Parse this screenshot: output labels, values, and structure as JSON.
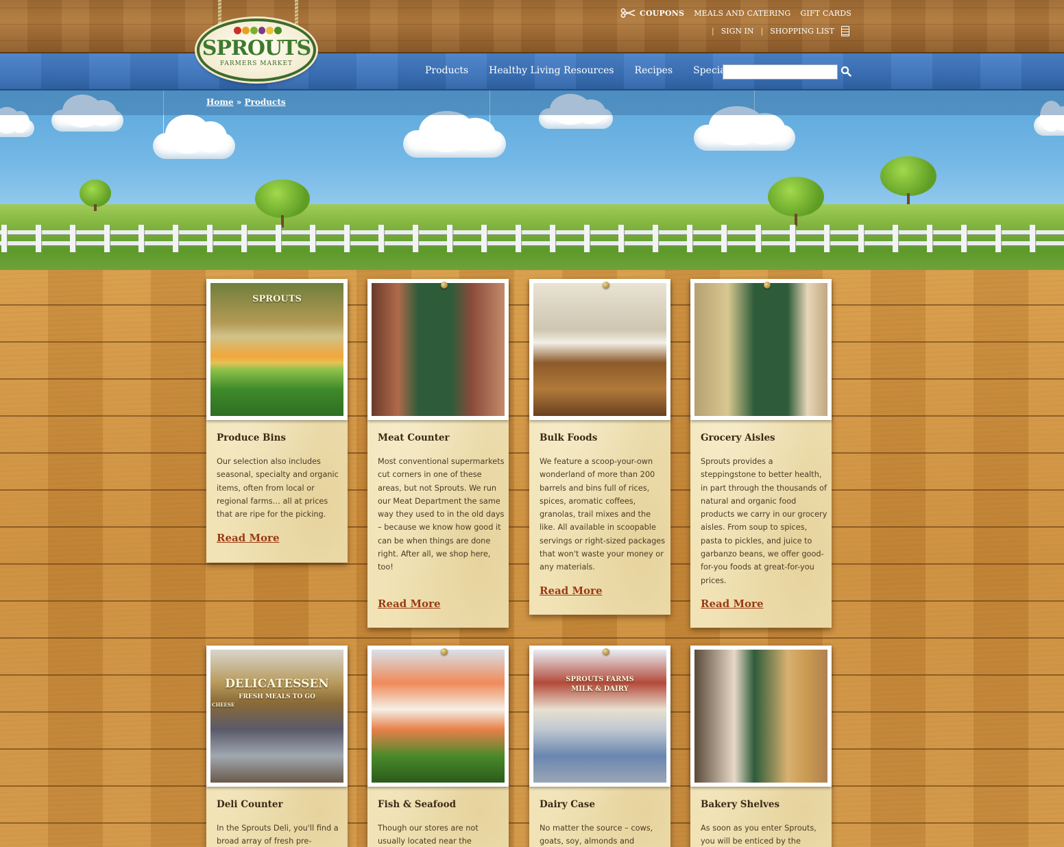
{
  "header": {
    "utility": {
      "coupons": "COUPONS",
      "meals": "MEALS AND CATERING",
      "gift_cards": "GIFT CARDS",
      "pipe": "|",
      "sign_in": "SIGN IN",
      "shopping_list": "SHOPPING LIST"
    },
    "logo": {
      "name": "SPROUTS",
      "sub": "FARMERS MARKET"
    },
    "nav": [
      {
        "label": "Products"
      },
      {
        "label": "Healthy Living Resources"
      },
      {
        "label": "Recipes"
      },
      {
        "label": "Specials"
      }
    ],
    "search": {
      "placeholder": ""
    }
  },
  "breadcrumb": {
    "home": "Home",
    "sep": "»",
    "current": "Products"
  },
  "colors": {
    "wood": "#c98a3a",
    "nav_blue": "#3b72b9",
    "read_more": "#9b3b12",
    "card_paper": "#f1e3b6"
  },
  "cards": [
    {
      "title": "Produce Bins",
      "text": "Our selection also includes seasonal, specialty and organic items, often from local or regional farms… all at prices that are ripe for the picking.",
      "read_more": "Read More",
      "photo_sign": "SPROUTS"
    },
    {
      "title": "Meat Counter",
      "text": "Most conventional supermarkets cut corners in one of these areas, but not Sprouts. We run our Meat Department the same way they used to in the old days – because we know how good it can be when things are done right. After all, we shop here, too!",
      "read_more": "Read More"
    },
    {
      "title": "Bulk Foods",
      "text": "We feature a scoop-your-own wonderland of more than 200 barrels and bins full of rices, spices, aromatic coffees, granolas, trail mixes and the like. All available in scoopable servings or right-sized packages that won't waste your money or any materials.",
      "read_more": "Read More"
    },
    {
      "title": "Grocery Aisles",
      "text": "Sprouts provides a steppingstone to better health, in part through the thousands of natural and organic food products we carry in our grocery aisles. From soup to spices, pasta to pickles, and juice to garbanzo beans, we offer good-for-you foods at great-for-you prices.",
      "read_more": "Read More"
    },
    {
      "title": "Deli Counter",
      "text": "In the Sprouts Deli, you'll find a broad array of fresh pre-",
      "photo_sign": "DELICATESSEN",
      "photo_sub": "FRESH MEALS TO GO",
      "photo_tag": "CHEESE"
    },
    {
      "title": "Fish & Seafood",
      "text": "Though our stores are not usually located near the"
    },
    {
      "title": "Dairy Case",
      "text": "No matter the source – cows, goats, soy, almonds and",
      "photo_sign": "SPROUTS FARMS",
      "photo_sub": "MILK & DAIRY"
    },
    {
      "title": "Bakery Shelves",
      "text": "As soon as you enter Sprouts, you will be enticed by the"
    }
  ]
}
